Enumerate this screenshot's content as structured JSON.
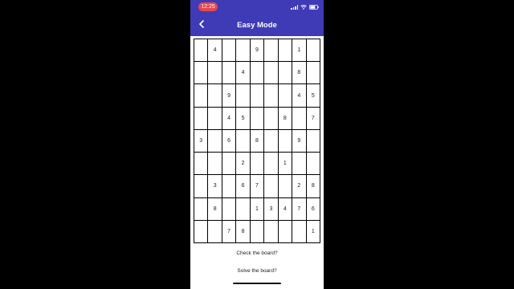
{
  "status_bar": {
    "time": "12:25",
    "icons": [
      "signal-icon",
      "wifi-icon",
      "battery-icon"
    ]
  },
  "header": {
    "title": "Easy Mode",
    "back_icon": "chevron-left-icon"
  },
  "board": {
    "rows": [
      [
        "",
        "4",
        "",
        "",
        "9",
        "",
        "",
        "1",
        ""
      ],
      [
        "",
        "",
        "",
        "4",
        "",
        "",
        "",
        "8",
        ""
      ],
      [
        "",
        "",
        "9",
        "",
        "",
        "",
        "",
        "4",
        "5"
      ],
      [
        "",
        "",
        "4",
        "5",
        "",
        "",
        "8",
        "",
        "7"
      ],
      [
        "3",
        "",
        "6",
        "",
        "8",
        "",
        "",
        "9",
        ""
      ],
      [
        "",
        "",
        "",
        "2",
        "",
        "",
        "1",
        "",
        ""
      ],
      [
        "",
        "3",
        "",
        "6",
        "7",
        "",
        "",
        "2",
        "8"
      ],
      [
        "",
        "8",
        "",
        "",
        "1",
        "3",
        "4",
        "7",
        "6"
      ],
      [
        "",
        "",
        "7",
        "8",
        "",
        "",
        "",
        "",
        "1"
      ]
    ]
  },
  "actions": {
    "check_label": "Check the board?",
    "solve_label": "Solve the board?"
  },
  "colors": {
    "app_bar": "#3f3ab5",
    "time_pill": "#e5484d",
    "grid_line": "#000000",
    "background": "#000000"
  }
}
